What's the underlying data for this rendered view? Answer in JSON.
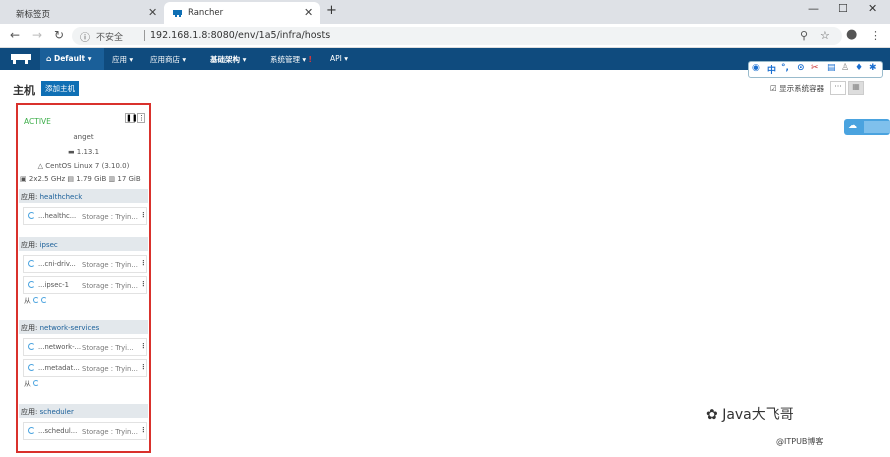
{
  "browser": {
    "tabs": [
      {
        "label": "新标签页"
      },
      {
        "label": "Rancher"
      }
    ],
    "address": {
      "insecure_label": "不安全",
      "url": "192.168.1.8:8080/env/1a5/infra/hosts"
    }
  },
  "rancher_nav": {
    "env_label": "Default",
    "items": [
      "应用",
      "应用商店",
      "基础架构",
      "系统管理",
      "API"
    ]
  },
  "toolbar": {
    "page_title": "主机",
    "add_host_label": "添加主机",
    "show_system_label": "显示系统容器",
    "more_label": "···"
  },
  "ext_bar": {
    "items": [
      "中",
      "°,",
      "⊙",
      "✂"
    ]
  },
  "host": {
    "state": "ACTIVE",
    "hostname": "anget",
    "docker_version": "1.13.1",
    "os": "CentOS Linux 7 (3.10.0)",
    "cpu": "2x2.5 GHz",
    "memory": "1.79 GiB",
    "disk": "17 GiB",
    "stacks": [
      {
        "prefix": "应用:",
        "name": "healthcheck",
        "services": [
          {
            "name": "...healthc...",
            "status": "Storage : Tryin..."
          }
        ]
      },
      {
        "prefix": "应用:",
        "name": "ipsec",
        "services": [
          {
            "name": "...cni-driv...",
            "status": "Storage : Tryin..."
          },
          {
            "name": "...ipsec-1",
            "status": "Storage : Tryin..."
          }
        ],
        "sidekick_label": "从"
      },
      {
        "prefix": "应用:",
        "name": "network-services",
        "services": [
          {
            "name": "...network-...",
            "status": "Storage : Tryi..."
          },
          {
            "name": "...metadat...",
            "status": "Storage : Tryin..."
          }
        ],
        "sidekick_label": "从"
      },
      {
        "prefix": "应用:",
        "name": "scheduler",
        "services": [
          {
            "name": "...schedul...",
            "status": "Storage : Tryin..."
          }
        ]
      }
    ]
  },
  "watermark": {
    "brand": "Java大飞哥",
    "credit": "@ITPUB博客"
  },
  "colors": {
    "nav_bg": "#0f4b7e",
    "accent": "#0f6fb4",
    "active": "#3cae49",
    "highlight": "#d9312c"
  }
}
